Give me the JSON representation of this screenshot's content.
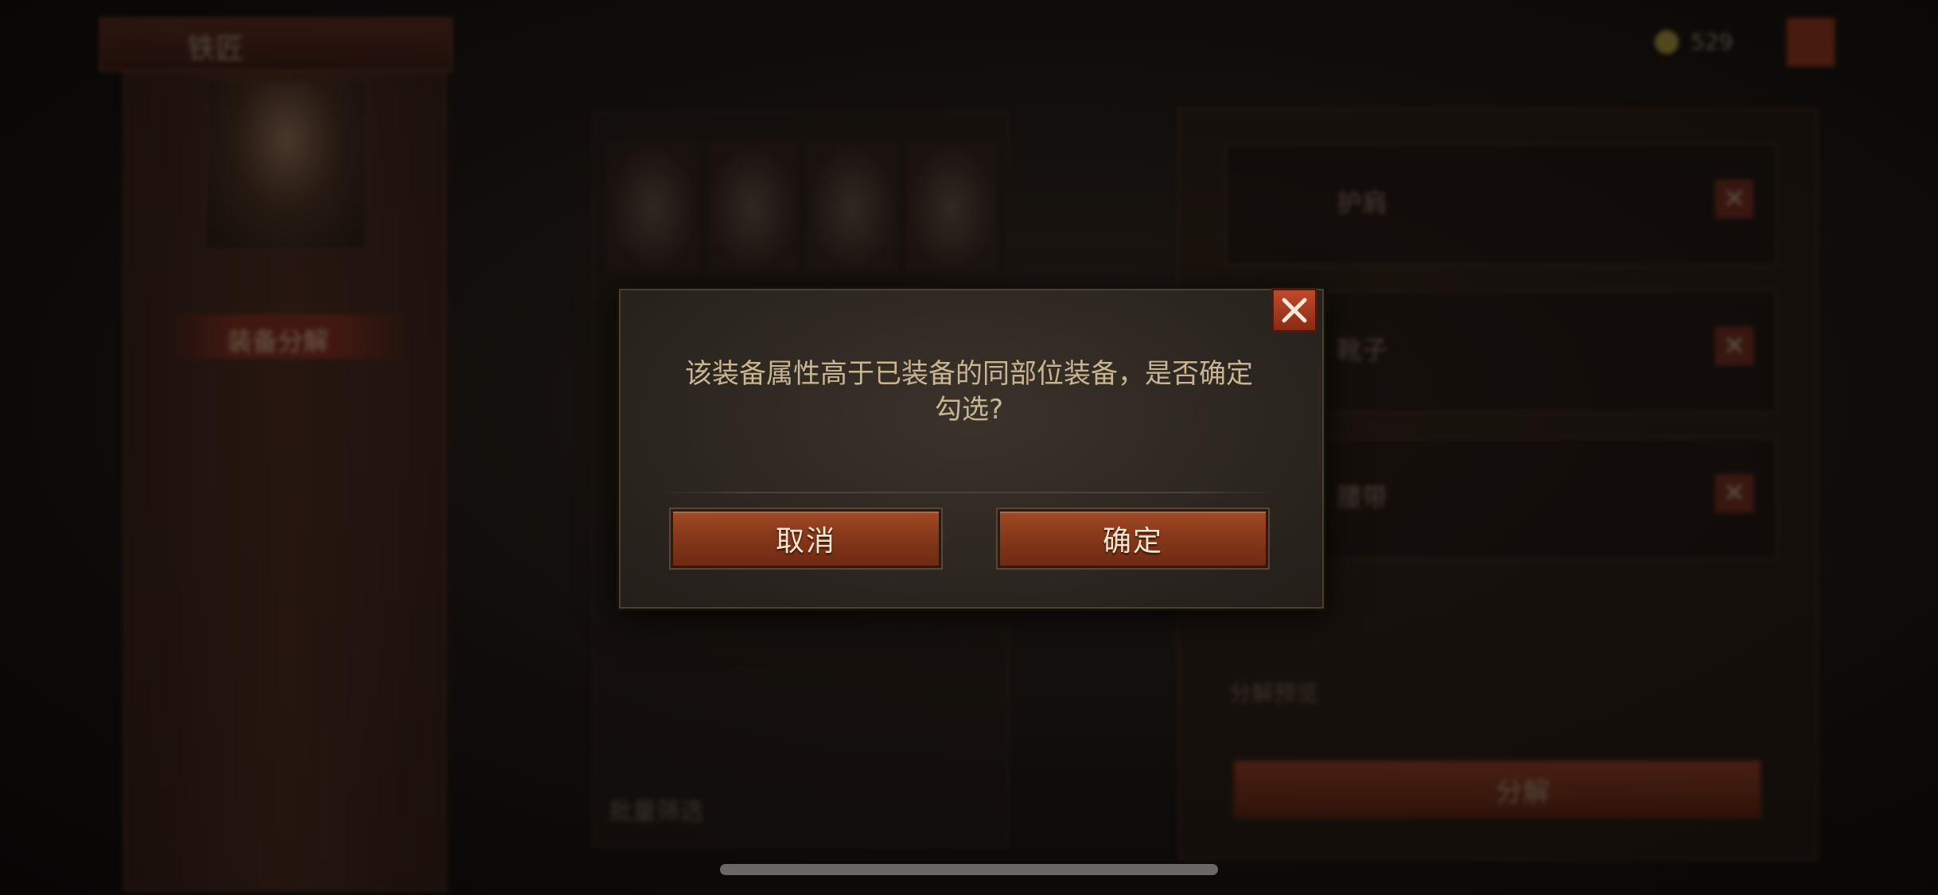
{
  "header": {
    "title": "铁匠",
    "currency_value": "529"
  },
  "left_panel": {
    "tab_label": "装备分解"
  },
  "center_panel": {
    "batch_filter_label": "批量筛选"
  },
  "right_panel": {
    "slots": [
      {
        "label": "护肩"
      },
      {
        "label": "靴子"
      },
      {
        "label": "腰带"
      }
    ],
    "salvage_preview_label": "分解预览",
    "salvage_button_label": "分解"
  },
  "dialog": {
    "message_line1": "该装备属性高于已装备的同部位装备，是否确定",
    "message_line2": "勾选?",
    "cancel_label": "取消",
    "confirm_label": "确定"
  },
  "colors": {
    "button_fill": "#8a3a1c",
    "dialog_text": "#c9b591",
    "close_red": "#c2492a"
  }
}
